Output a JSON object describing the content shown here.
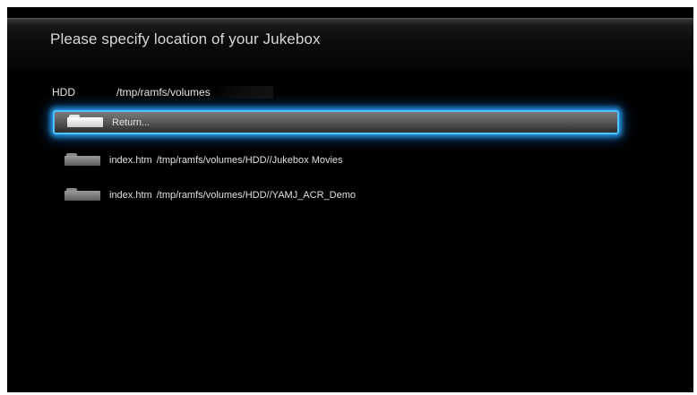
{
  "dialog": {
    "title": "Please specify location of your Jukebox"
  },
  "location": {
    "drive": "HDD",
    "path": "/tmp/ramfs/volumes"
  },
  "items": [
    {
      "icon": "folder-icon",
      "name": "Return...",
      "path": "",
      "selected": true
    },
    {
      "icon": "folder-icon",
      "name": "index.htm",
      "path": "/tmp/ramfs/volumes/HDD//Jukebox Movies",
      "selected": false
    },
    {
      "icon": "folder-icon",
      "name": "index.htm",
      "path": "/tmp/ramfs/volumes/HDD//YAMJ_ACR_Demo",
      "selected": false
    }
  ],
  "colors": {
    "background": "#000000",
    "selection_glow": "#4fc3ff",
    "text": "#e0e0e0"
  }
}
